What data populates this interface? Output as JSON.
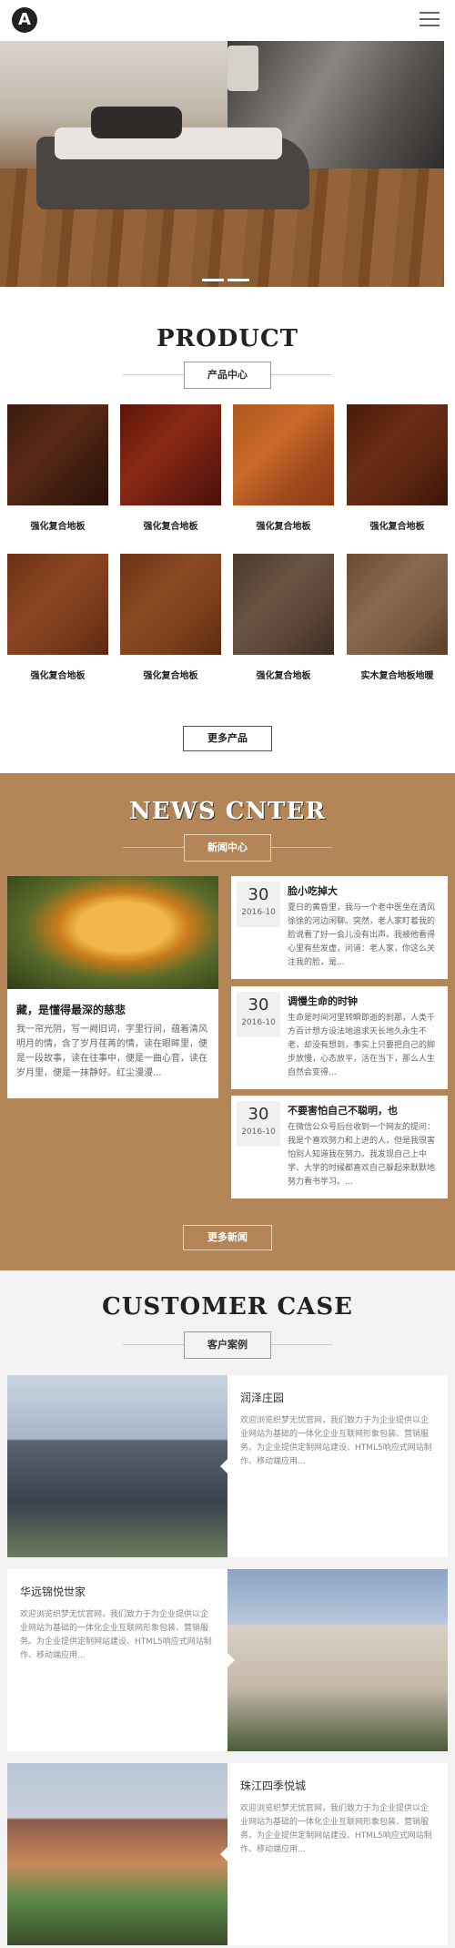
{
  "header": {
    "logo_letter": "A",
    "menu_icon": "hamburger-icon"
  },
  "banner": {
    "slides": 2
  },
  "product": {
    "title": "PRODUCT",
    "subtitle": "产品中心",
    "items": [
      {
        "caption": "强化复合地板",
        "color": "#4a2414"
      },
      {
        "caption": "强化复合地板",
        "color": "#6a1c10"
      },
      {
        "caption": "强化复合地板",
        "color": "#a04a1e"
      },
      {
        "caption": "强化复合地板",
        "color": "#5a2410"
      },
      {
        "caption": "强化复合地板",
        "color": "#7a3a1c"
      },
      {
        "caption": "强化复合地板",
        "color": "#7a3e1a"
      },
      {
        "caption": "强化复合地板",
        "color": "#5a4436"
      },
      {
        "caption": "实木复合地板地暖",
        "color": "#7a5a40"
      }
    ],
    "more_label": "更多产品"
  },
  "news": {
    "title": "NEWS CNTER",
    "subtitle": "新闻中心",
    "main": {
      "title": "藏，是懂得最深的慈悲",
      "text": "我一帘光阴，写一阙旧词，字里行间，蕴着清风明月的情，含了岁月荏苒的情，读在眼眸里，便是一段故事，读在往事中，便是一曲心音，读在岁月里，便是一抹静好。红尘漫漫..."
    },
    "items": [
      {
        "day": "30",
        "ym": "2016-10",
        "title": "脸小吃掉大",
        "text": "夏日的黄昏里，我与一个老中医坐在清风徐徐的河边闲聊。突然，老人家盯着我的脸说看了好一会儿没有出声。我被他看得心里有些发虚，问道：老人家，你这么关注我的脸，是..."
      },
      {
        "day": "30",
        "ym": "2016-10",
        "title": "调慢生命的时钟",
        "text": "生命是时间河里转瞬即逝的刹那，人类千方百计想方设法地追求天长地久永生不老，却没有想到，事实上只要把自己的脚步放慢，心态放平，活在当下，那么人生自然会变得..."
      },
      {
        "day": "30",
        "ym": "2016-10",
        "title": "不要害怕自己不聪明，也",
        "text": "在微信公众号后台收到一个网友的提问：我是个喜欢努力和上进的人，但是我很害怕别人知道我在努力。我发现自己上中学、大学的时候都喜欢自己躲起来默默地努力看书学习。..."
      }
    ],
    "more_label": "更多新闻"
  },
  "cases": {
    "title": "CUSTOMER CASE",
    "subtitle": "客户案例",
    "items": [
      {
        "title": "润泽庄园",
        "text": "欢迎浏览织梦无忧官网，我们致力于为企业提供以企业网站为基础的一体化企业互联网形象包装、营销服务。为企业提供定制网站建设、HTML5响应式网站制作、移动端应用..."
      },
      {
        "title": "华远锦悦世家",
        "text": "欢迎浏览织梦无忧官网，我们致力于为企业提供以企业网站为基础的一体化企业互联网形象包装、营销服务。为企业提供定制网站建设、HTML5响应式网站制作、移动端应用..."
      },
      {
        "title": "珠江四季悦城",
        "text": "欢迎浏览织梦无忧官网，我们致力于为企业提供以企业网站为基础的一体化企业互联网形象包装、营销服务。为企业提供定制网站建设、HTML5响应式网站制作、移动端应用..."
      }
    ]
  },
  "colors": {
    "accent": "#b38557"
  }
}
